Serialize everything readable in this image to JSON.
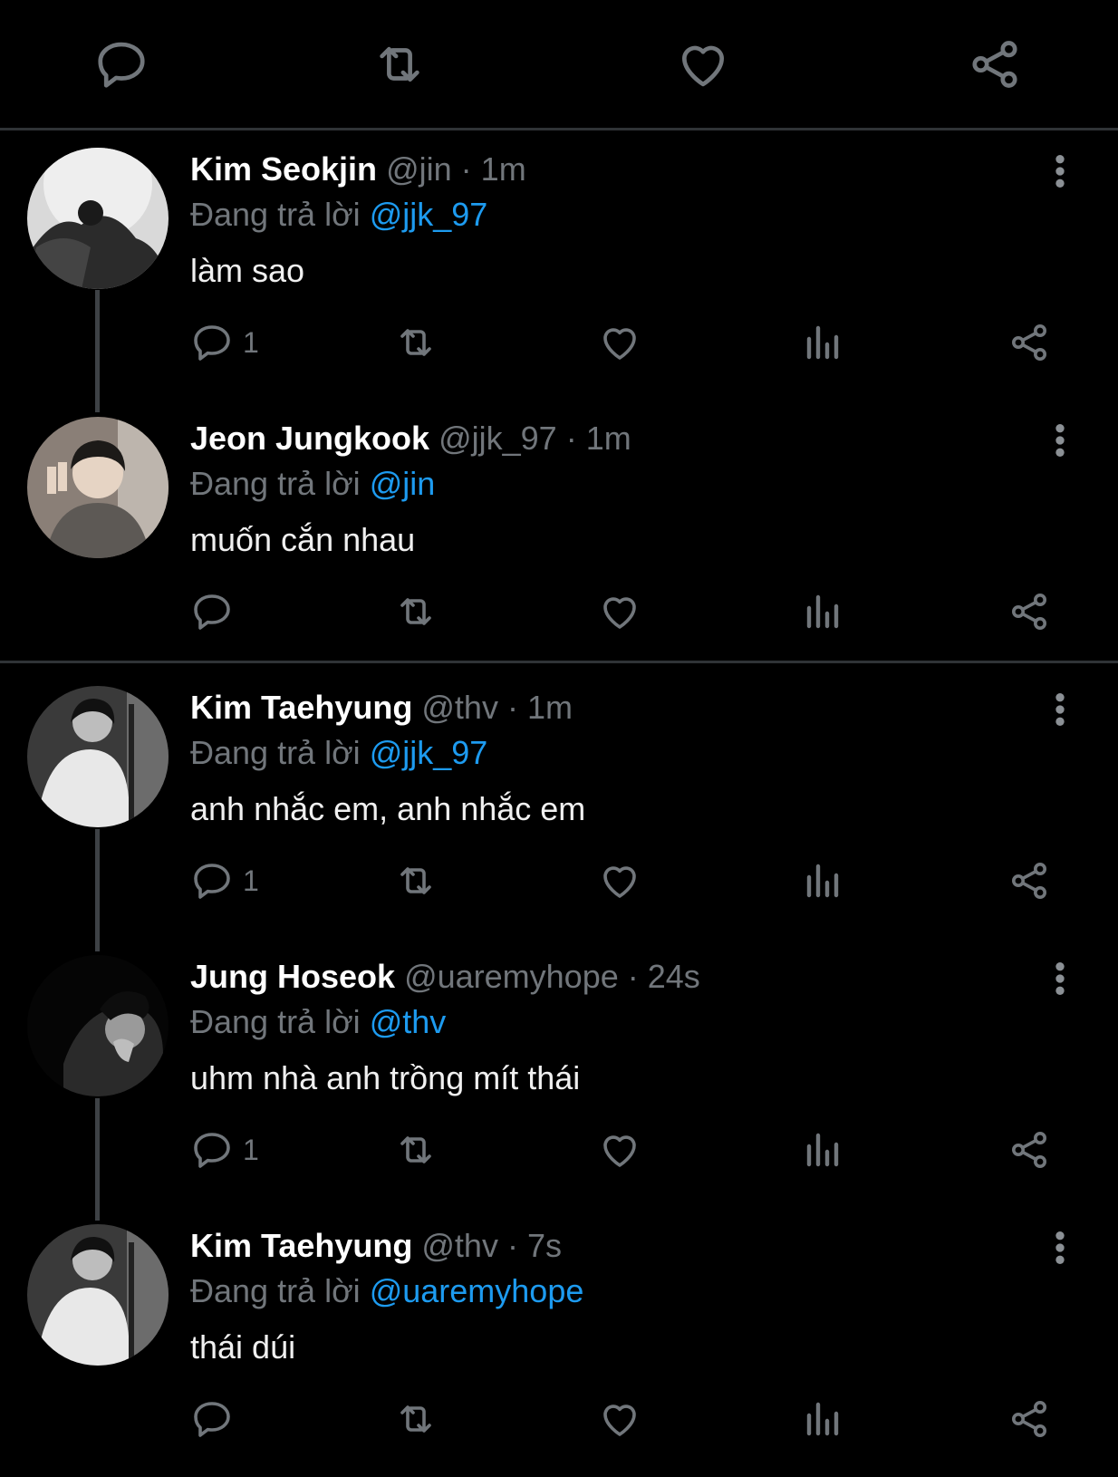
{
  "top_actions": {
    "icons": [
      "reply-icon",
      "retweet-icon",
      "like-icon",
      "share-icon"
    ]
  },
  "colors": {
    "background": "#000000",
    "name": "#ffffff",
    "muted": "#71767b",
    "mention": "#1d9bf0",
    "divider": "#2f3336"
  },
  "tweets": [
    {
      "name": "Kim Seokjin",
      "handle": "@jin",
      "dot": "·",
      "time": "1m",
      "reply_prefix": "Đang trả lời ",
      "reply_to": "@jjk_97",
      "text": "làm sao",
      "reply_count": "1"
    },
    {
      "name": "Jeon Jungkook",
      "handle": "@jjk_97",
      "dot": "·",
      "time": "1m",
      "reply_prefix": "Đang trả lời ",
      "reply_to": "@jin",
      "text": "muốn cắn nhau",
      "reply_count": ""
    },
    {
      "name": "Kim Taehyung",
      "handle": "@thv",
      "dot": "·",
      "time": "1m",
      "reply_prefix": "Đang trả lời ",
      "reply_to": "@jjk_97",
      "text": "anh nhắc em, anh nhắc em",
      "reply_count": "1"
    },
    {
      "name": "Jung Hoseok",
      "handle": "@uaremyhope",
      "dot": "·",
      "time": "24s",
      "reply_prefix": "Đang trả lời ",
      "reply_to": "@thv",
      "text": "uhm nhà anh trồng mít thái",
      "reply_count": "1"
    },
    {
      "name": "Kim Taehyung",
      "handle": "@thv",
      "dot": "·",
      "time": "7s",
      "reply_prefix": "Đang trả lời ",
      "reply_to": "@uaremyhope",
      "text": "thái dúi",
      "reply_count": ""
    }
  ]
}
